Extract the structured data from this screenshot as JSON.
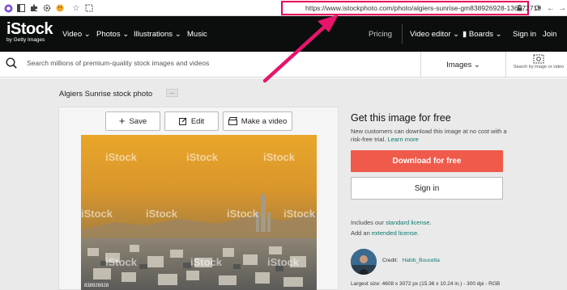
{
  "browser": {
    "url": "https://www.istockphoto.com/photo/algiers-sunrise-gm838926928-136572719"
  },
  "nav": {
    "logo": "iStock",
    "logo_sub": "by Getty Images",
    "items": [
      "Video",
      "Photos",
      "Illustrations",
      "Music"
    ],
    "pricing": "Pricing",
    "video_editor": "Video editor",
    "boards": "Boards",
    "sign_in": "Sign in",
    "join": "Join"
  },
  "search": {
    "placeholder": "Search millions of premium-quality stock images and videos",
    "type": "Images",
    "visual_search_label": "Search by image or video"
  },
  "photo": {
    "title": "Algiers Sunrise stock photo",
    "more": "...",
    "actions": [
      "Save",
      "Edit",
      "Make a video"
    ],
    "watermark": "iStock",
    "id_text": "838926928"
  },
  "offer": {
    "title": "Get this image for free",
    "description": "New customers can download this image at no cost with a risk-free trial.",
    "learn_more": "Learn more",
    "download_label": "Download for free",
    "signin_label": "Sign in",
    "license_prefix": "Includes our",
    "license_link": "standard license",
    "add_prefix": "Add an",
    "add_link": "extended license",
    "credit_label": "Credit:",
    "credit_name": "Habib_Boucetta",
    "largest_size": "Largest size: 4608 x 3072 px (15.36 x 10.24 in.) - 300 dpi - RGB"
  },
  "colors": {
    "url_highlight": "#e6005c",
    "download_button": "#ef5a4a",
    "link": "#0b7a6f",
    "nav_bg": "#0c0d0d"
  }
}
